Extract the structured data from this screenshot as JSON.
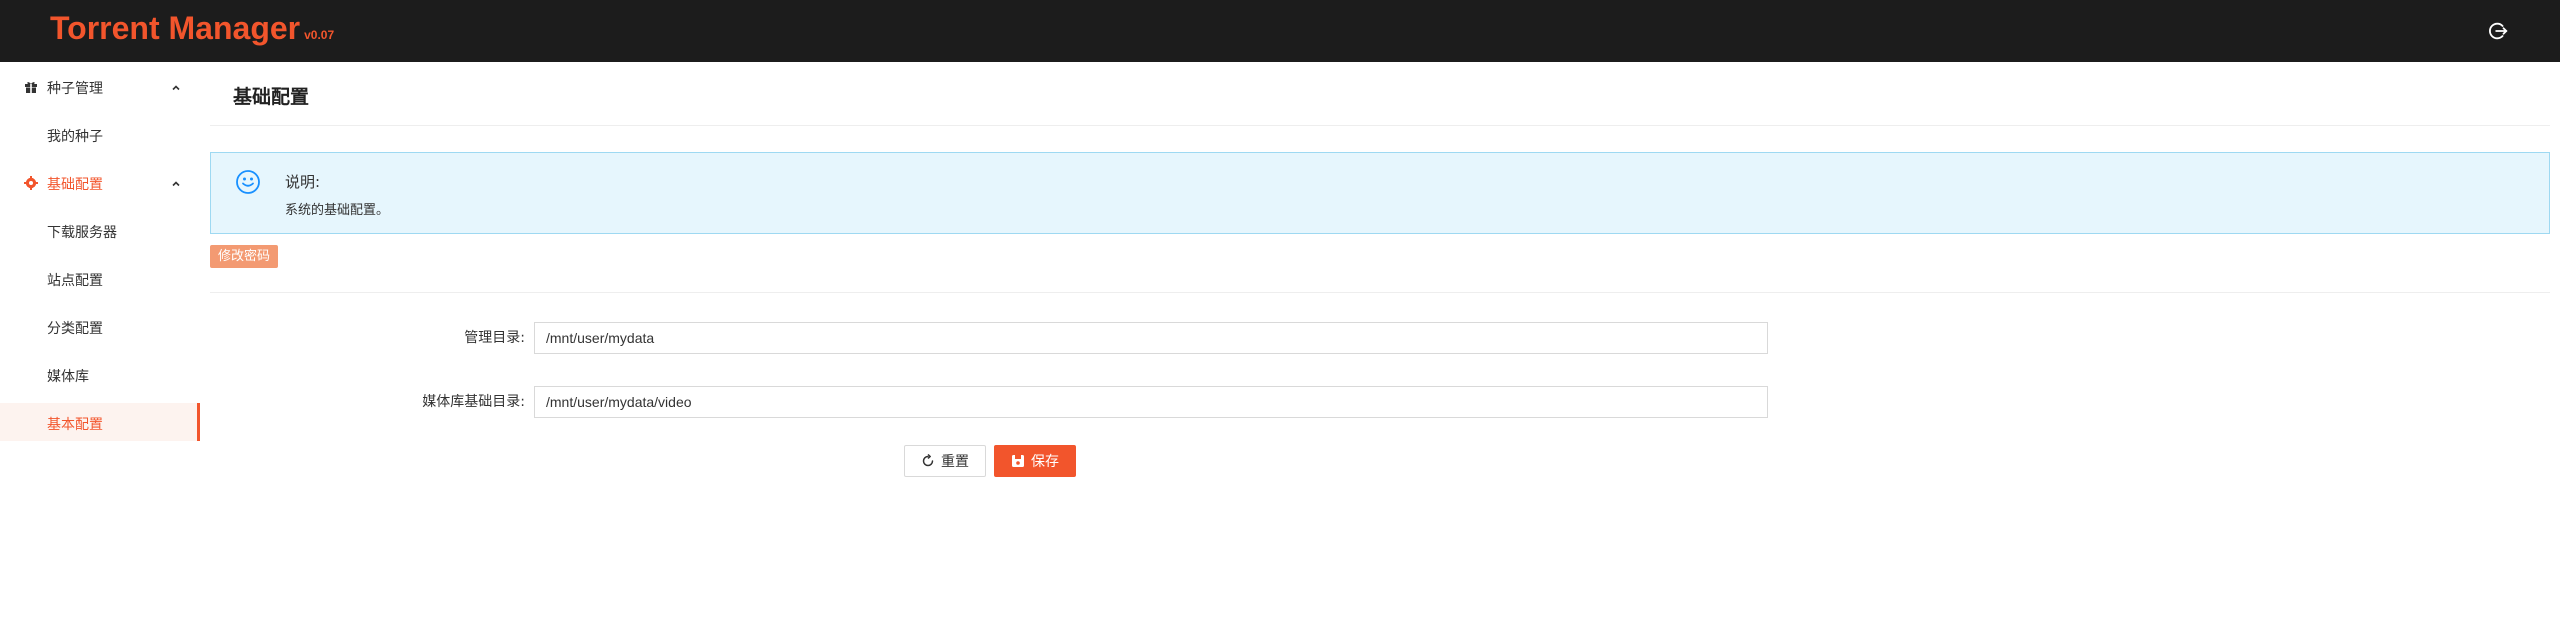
{
  "app": {
    "title": "Torrent Manager",
    "version": "v0.07",
    "brand_color": "#f2552c"
  },
  "header": {
    "logout_icon": "logout-icon"
  },
  "sidebar": {
    "groups": [
      {
        "label": "种子管理",
        "icon": "gift-icon",
        "expanded": true,
        "items": [
          {
            "label": "我的种子"
          }
        ]
      },
      {
        "label": "基础配置",
        "icon": "gear-icon",
        "expanded": true,
        "active": true,
        "items": [
          {
            "label": "下载服务器"
          },
          {
            "label": "站点配置"
          },
          {
            "label": "分类配置"
          },
          {
            "label": "媒体库"
          },
          {
            "label": "基本配置",
            "selected": true
          }
        ]
      }
    ]
  },
  "main": {
    "page_title": "基础配置",
    "notice": {
      "icon": "smile-icon",
      "title": "说明:",
      "text": "系统的基础配置。"
    },
    "change_password_label": "修改密码",
    "form": {
      "fields": [
        {
          "label": "管理目录:",
          "value": "/mnt/user/mydata"
        },
        {
          "label": "媒体库基础目录:",
          "value": "/mnt/user/mydata/video"
        }
      ],
      "reset_label": "重置",
      "save_label": "保存"
    }
  }
}
